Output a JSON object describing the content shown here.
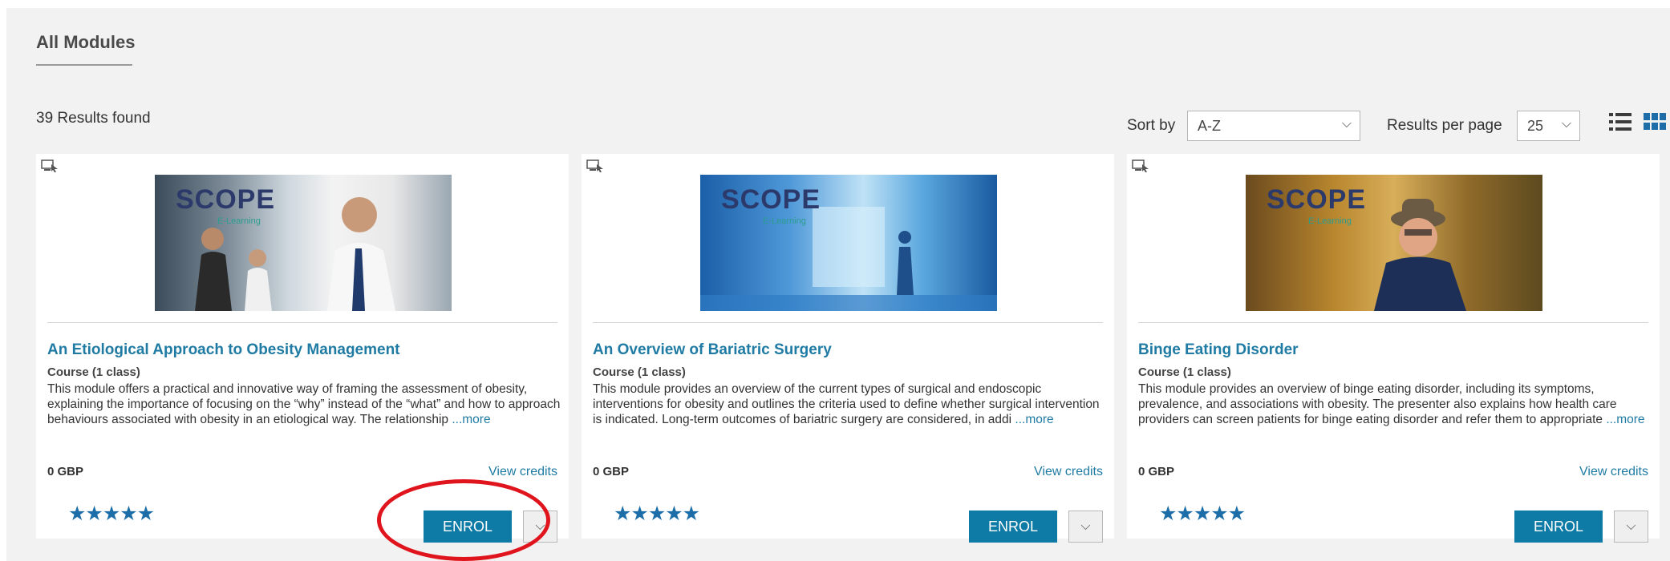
{
  "page": {
    "title": "All Modules",
    "results_text": "39 Results found"
  },
  "toolbar": {
    "sort_label": "Sort by",
    "sort_value": "A-Z",
    "rpp_label": "Results per page",
    "rpp_value": "25",
    "view_icons": [
      "list-view-icon",
      "grid-view-icon"
    ]
  },
  "colors": {
    "accent": "#0e7aa6",
    "link": "#1f7ba3",
    "stars": "#1d6ea8",
    "annotation": "#e0141c"
  },
  "cards": [
    {
      "logo": "SCOPE",
      "logo_sub": "E-Learning",
      "title": "An Etiological Approach to Obesity Management",
      "type": "Course (1 class)",
      "description": "This module offers a practical and innovative way of framing the assessment of obesity, explaining the importance of focusing on the “why” instead of the “what” and how to approach behaviours associated with obesity in an etiological way. The relationship ",
      "more": "...more",
      "price": "0 GBP",
      "credits": "View credits",
      "rating": 5,
      "stars": "★★★★★",
      "enrol": "ENROL",
      "dropdown_icon": "chevron-down-icon"
    },
    {
      "logo": "SCOPE",
      "logo_sub": "E-Learning",
      "title": "An Overview of Bariatric Surgery",
      "type": "Course (1 class)",
      "description": "This module provides an overview of the current types of surgical and endoscopic interventions for obesity and outlines the criteria used to define whether surgical intervention is indicated. Long-term outcomes of bariatric surgery are considered, in addi ",
      "more": "...more",
      "price": "0 GBP",
      "credits": "View credits",
      "rating": 5,
      "stars": "★★★★★",
      "enrol": "ENROL",
      "dropdown_icon": "chevron-down-icon"
    },
    {
      "logo": "SCOPE",
      "logo_sub": "E-Learning",
      "title": "Binge Eating Disorder",
      "type": "Course (1 class)",
      "description": "This module provides an overview of binge eating disorder, including its symptoms, prevalence, and associations with obesity. The presenter also explains how health care providers can screen patients for binge eating disorder and refer them to appropriate ",
      "more": "...more",
      "price": "0 GBP",
      "credits": "View credits",
      "rating": 5,
      "stars": "★★★★★",
      "enrol": "ENROL",
      "dropdown_icon": "chevron-down-icon"
    }
  ]
}
